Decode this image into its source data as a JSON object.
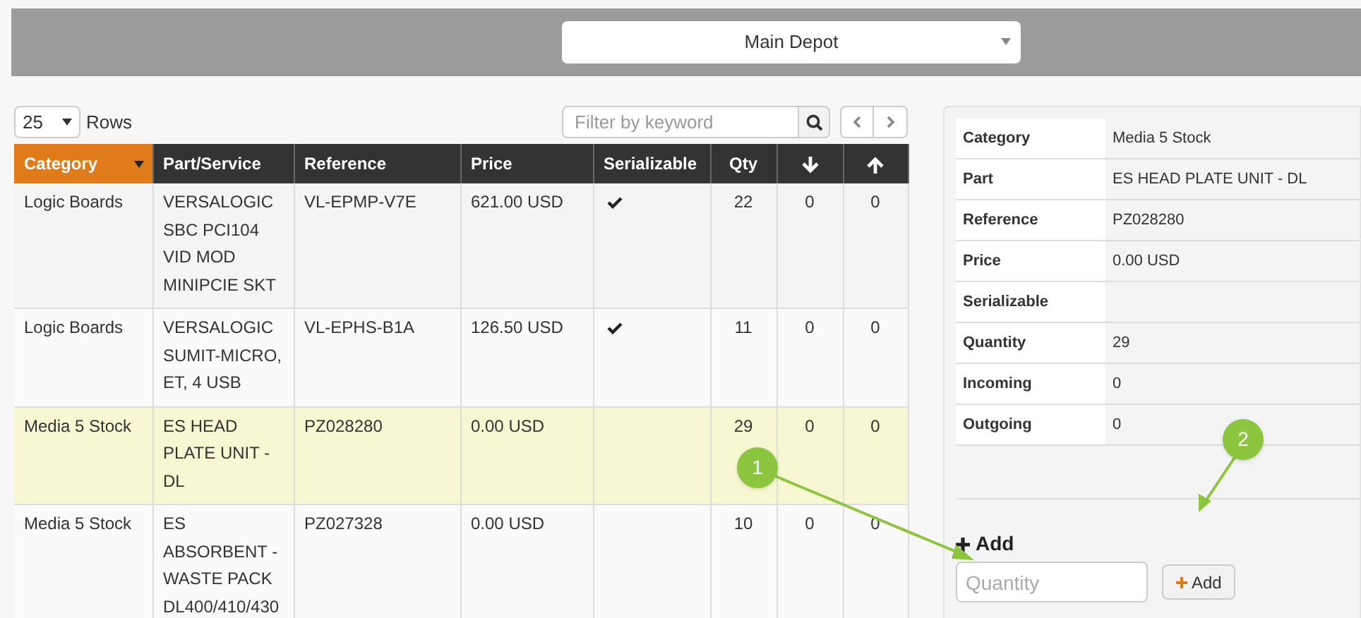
{
  "depot_select": {
    "value": "Main Depot"
  },
  "rows_select": {
    "value": "25",
    "label": "Rows"
  },
  "filter": {
    "placeholder": "Filter by keyword"
  },
  "table": {
    "columns": [
      {
        "label": "Category",
        "kind": "text",
        "sorted": true
      },
      {
        "label": "Part/Service",
        "kind": "text",
        "sorted": false
      },
      {
        "label": "Reference",
        "kind": "text",
        "sorted": false
      },
      {
        "label": "Price",
        "kind": "text",
        "sorted": false
      },
      {
        "label": "Serializable",
        "kind": "text",
        "sorted": false
      },
      {
        "label": "Qty",
        "kind": "text",
        "sorted": false
      },
      {
        "kind": "down",
        "sorted": false
      },
      {
        "kind": "up",
        "sorted": false
      }
    ],
    "rows": [
      {
        "category": "Logic Boards",
        "part": "VERSALOGIC SBC PCI104 VID MOD MINIPCIE SKT",
        "reference": "VL-EPMP-V7E",
        "price": "621.00 USD",
        "serializable": true,
        "qty": "22",
        "incoming": "0",
        "outgoing": "0",
        "selected": false
      },
      {
        "category": "Logic Boards",
        "part": "VERSALOGIC SUMIT-MICRO, ET, 4 USB",
        "reference": "VL-EPHS-B1A",
        "price": "126.50 USD",
        "serializable": true,
        "qty": "11",
        "incoming": "0",
        "outgoing": "0",
        "selected": false
      },
      {
        "category": "Media 5 Stock",
        "part": "ES HEAD PLATE UNIT - DL",
        "reference": "PZ028280",
        "price": "0.00 USD",
        "serializable": false,
        "qty": "29",
        "incoming": "0",
        "outgoing": "0",
        "selected": true
      },
      {
        "category": "Media 5 Stock",
        "part": "ES ABSORBENT - WASTE PACK DL400/410/430",
        "reference": "PZ027328",
        "price": "0.00 USD",
        "serializable": false,
        "qty": "10",
        "incoming": "0",
        "outgoing": "0",
        "selected": false
      }
    ]
  },
  "details": [
    {
      "label": "Category",
      "value": "Media 5 Stock"
    },
    {
      "label": "Part",
      "value": "ES HEAD PLATE UNIT - DL"
    },
    {
      "label": "Reference",
      "value": "PZ028280"
    },
    {
      "label": "Price",
      "value": "0.00 USD"
    },
    {
      "label": "Serializable"
    },
    {
      "label": "Quantity",
      "value": "29"
    },
    {
      "label": "Incoming",
      "value": "0"
    },
    {
      "label": "Outgoing",
      "value": "0"
    }
  ],
  "add_form": {
    "heading": "Add",
    "placeholder": "Quantity",
    "button": "Add"
  },
  "callouts": [
    {
      "label": "1"
    },
    {
      "label": "2"
    }
  ]
}
